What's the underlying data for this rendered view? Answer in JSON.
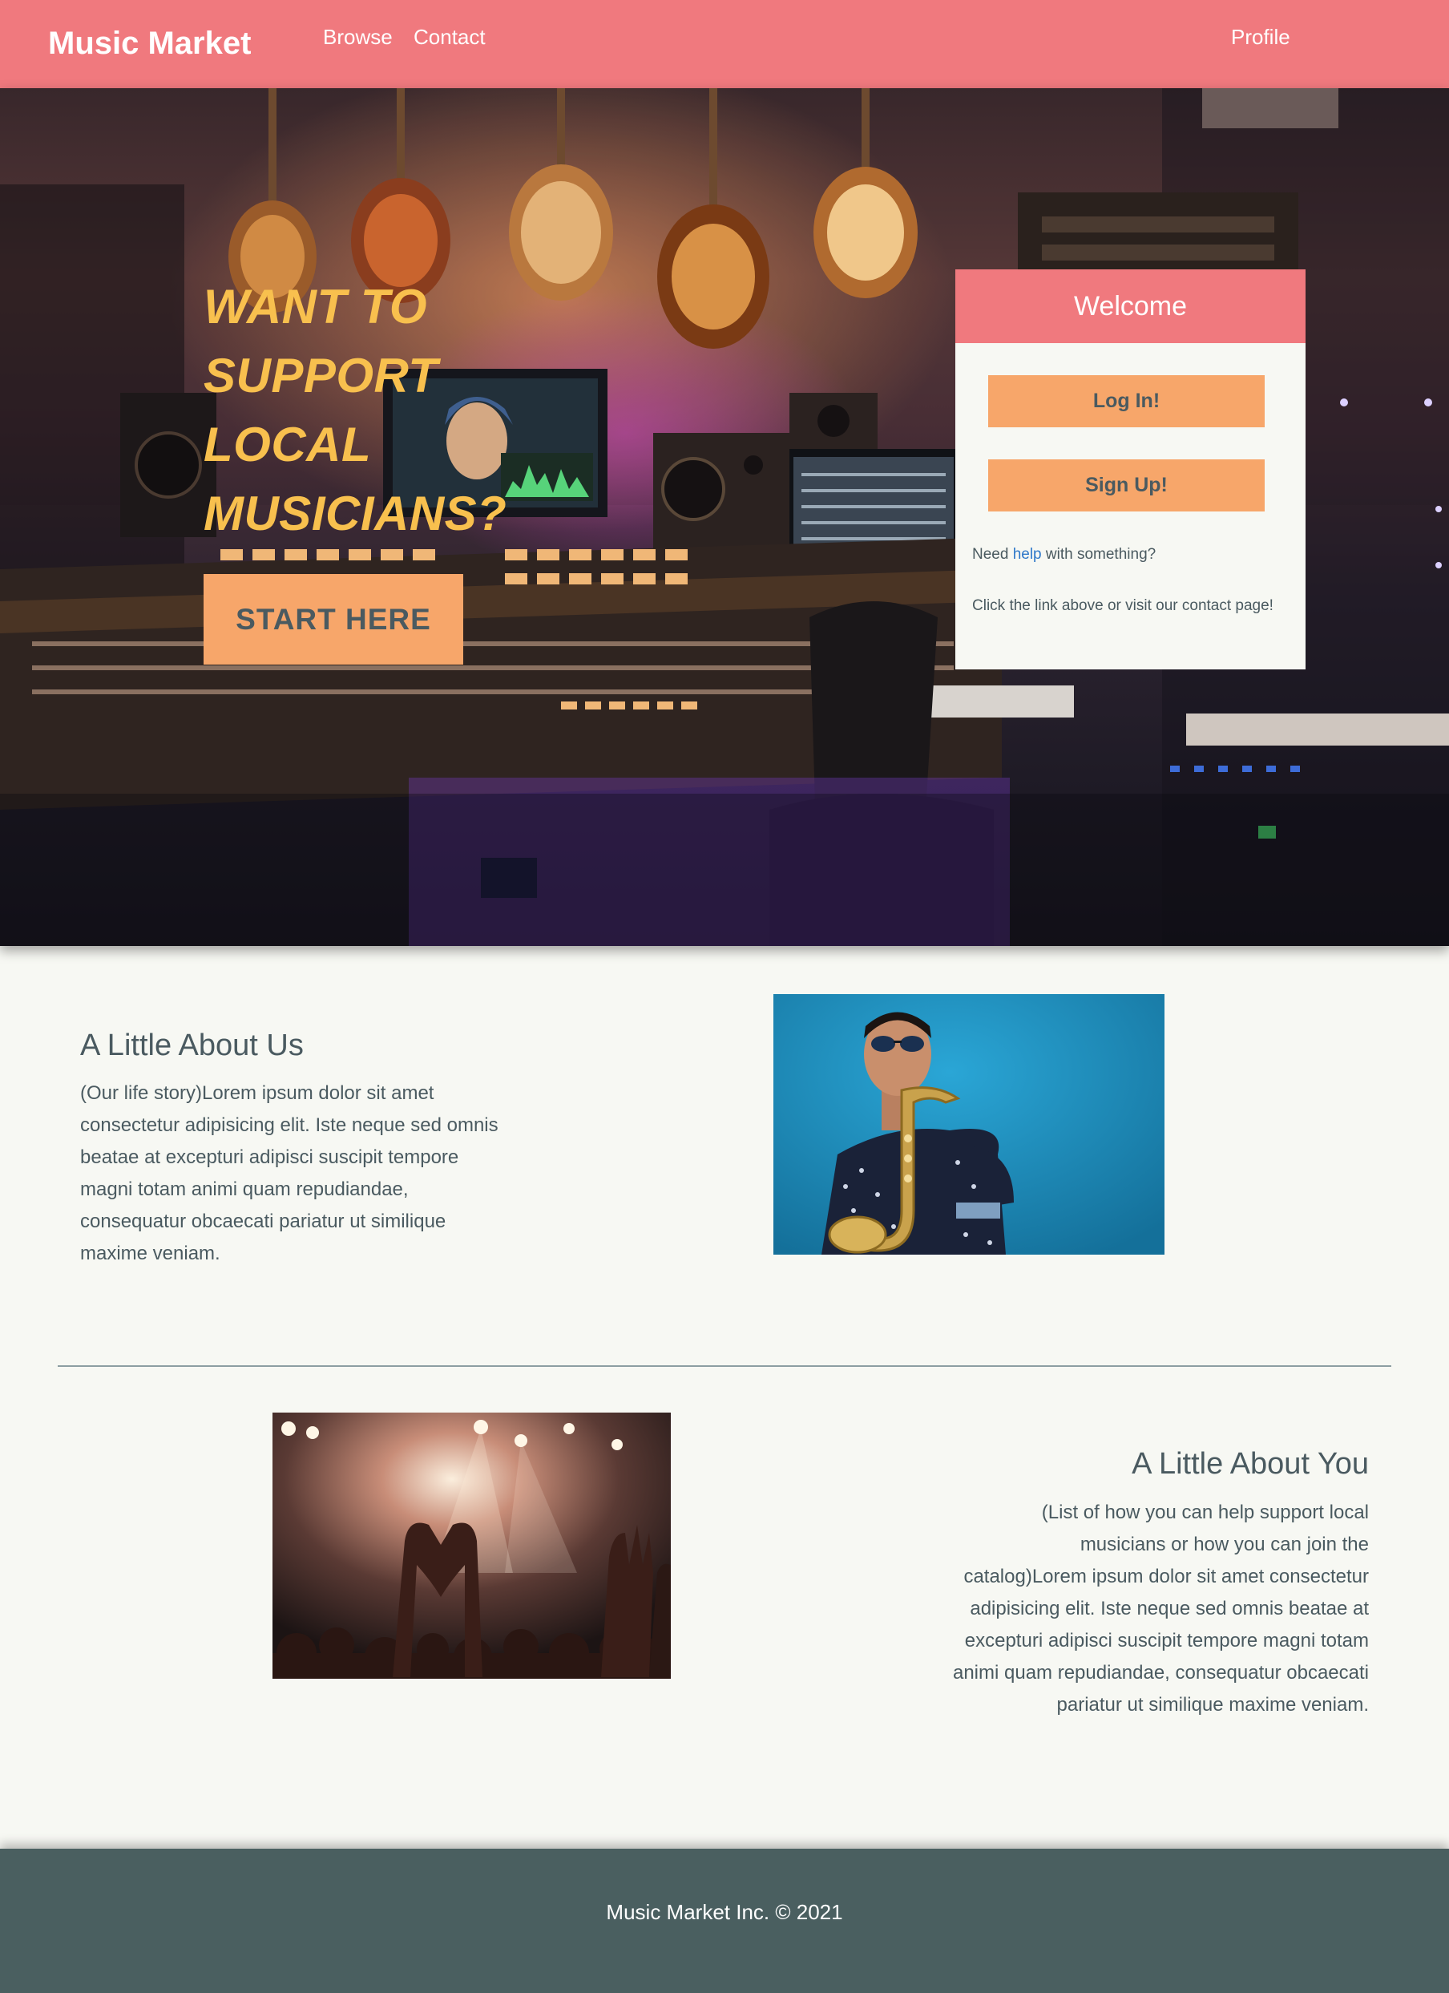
{
  "navbar": {
    "brand": "Music Market",
    "links": [
      {
        "label": "Browse"
      },
      {
        "label": "Contact"
      }
    ],
    "profile_label": "Profile"
  },
  "hero": {
    "heading": "WANT TO SUPPORT LOCAL MUSICIANS?",
    "cta_label": "START HERE",
    "image": "music-studio-with-guitars-and-mixing-console"
  },
  "welcome_card": {
    "title": "Welcome",
    "login_label": "Log In!",
    "signup_label": "Sign Up!",
    "help_prefix": "Need ",
    "help_link": "help",
    "help_suffix": " with something?",
    "contact_text": "Click the link above or visit our contact page!"
  },
  "about_us": {
    "title": "A Little About Us",
    "body": "(Our life story)Lorem ipsum dolor sit amet consectetur adipisicing elit. Iste neque sed omnis beatae at excepturi adipisci suscipit tempore magni totam animi quam repudiandae, consequatur obcaecati pariatur ut similique maxime veniam.",
    "image": "saxophone-player-against-blue-wall"
  },
  "about_you": {
    "title": "A Little About You",
    "body": "(List of how you can help support local musicians or how you can join the catalog)Lorem ipsum dolor sit amet consectetur adipisicing elit. Iste neque sed omnis beatae at excepturi adipisci suscipit tempore magni totam animi quam repudiandae, consequatur obcaecati pariatur ut similique maxime veniam.",
    "image": "concert-crowd-making-heart-hands"
  },
  "footer": {
    "text": "Music Market Inc. © 2021"
  },
  "colors": {
    "primary": "#f0797e",
    "accent": "#f7a66a",
    "hero_heading": "#f8c04e",
    "text": "#4a5a60",
    "page_background": "#f7f8f3",
    "footer": "#4a5f60",
    "link": "#2e78c9"
  }
}
